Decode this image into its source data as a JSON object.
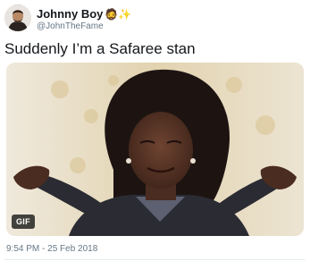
{
  "tweet": {
    "author": {
      "display_name": "Johnny Boy",
      "name_emojis": "🧔✨",
      "handle": "@JohnTheFame"
    },
    "text": "Suddenly I’m a Safaree stan",
    "media": {
      "type": "gif",
      "badge": "GIF",
      "description": "GIF"
    },
    "timestamp": "9:54 PM - 25 Feb 2018"
  },
  "colors": {
    "text": "#14171a",
    "secondary_text": "#657786",
    "divider": "#e6ecf0"
  }
}
